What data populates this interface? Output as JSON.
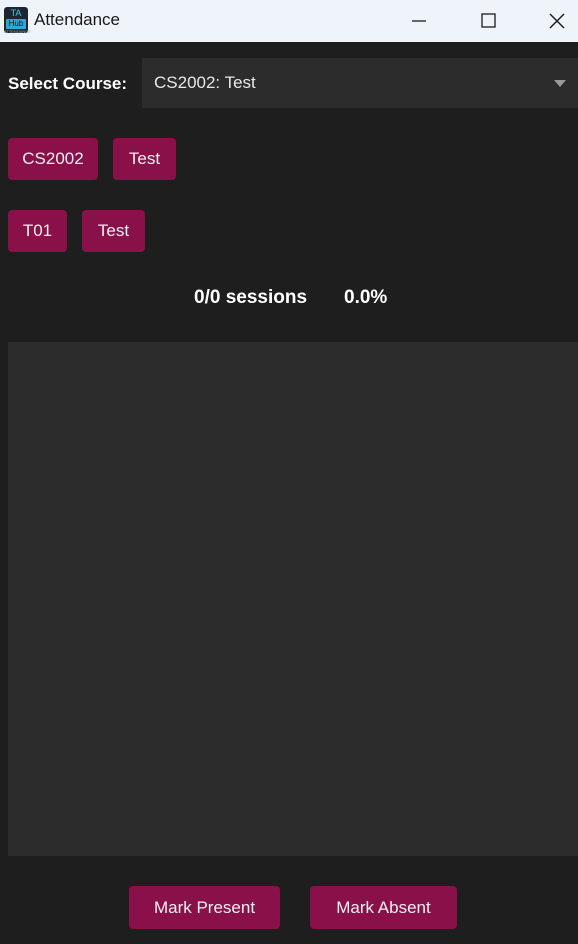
{
  "window": {
    "title": "Attendance",
    "icon_text_top": "TA",
    "icon_text_sub": "Hub",
    "icon_text_tiny": "ATTENDANCE"
  },
  "course_select": {
    "label": "Select Course:",
    "value": "CS2002: Test"
  },
  "course_chips": [
    "CS2002",
    "Test"
  ],
  "group_chips": [
    "T01",
    "Test"
  ],
  "stats": {
    "sessions": "0/0 sessions",
    "percent": "0.0%"
  },
  "actions": {
    "present_label": "Mark Present",
    "absent_label": "Mark Absent"
  },
  "colors": {
    "accent": "#8a1049",
    "background": "#1e1e1f",
    "panel": "#2c2c2c",
    "titlebar": "#eef4f9"
  }
}
